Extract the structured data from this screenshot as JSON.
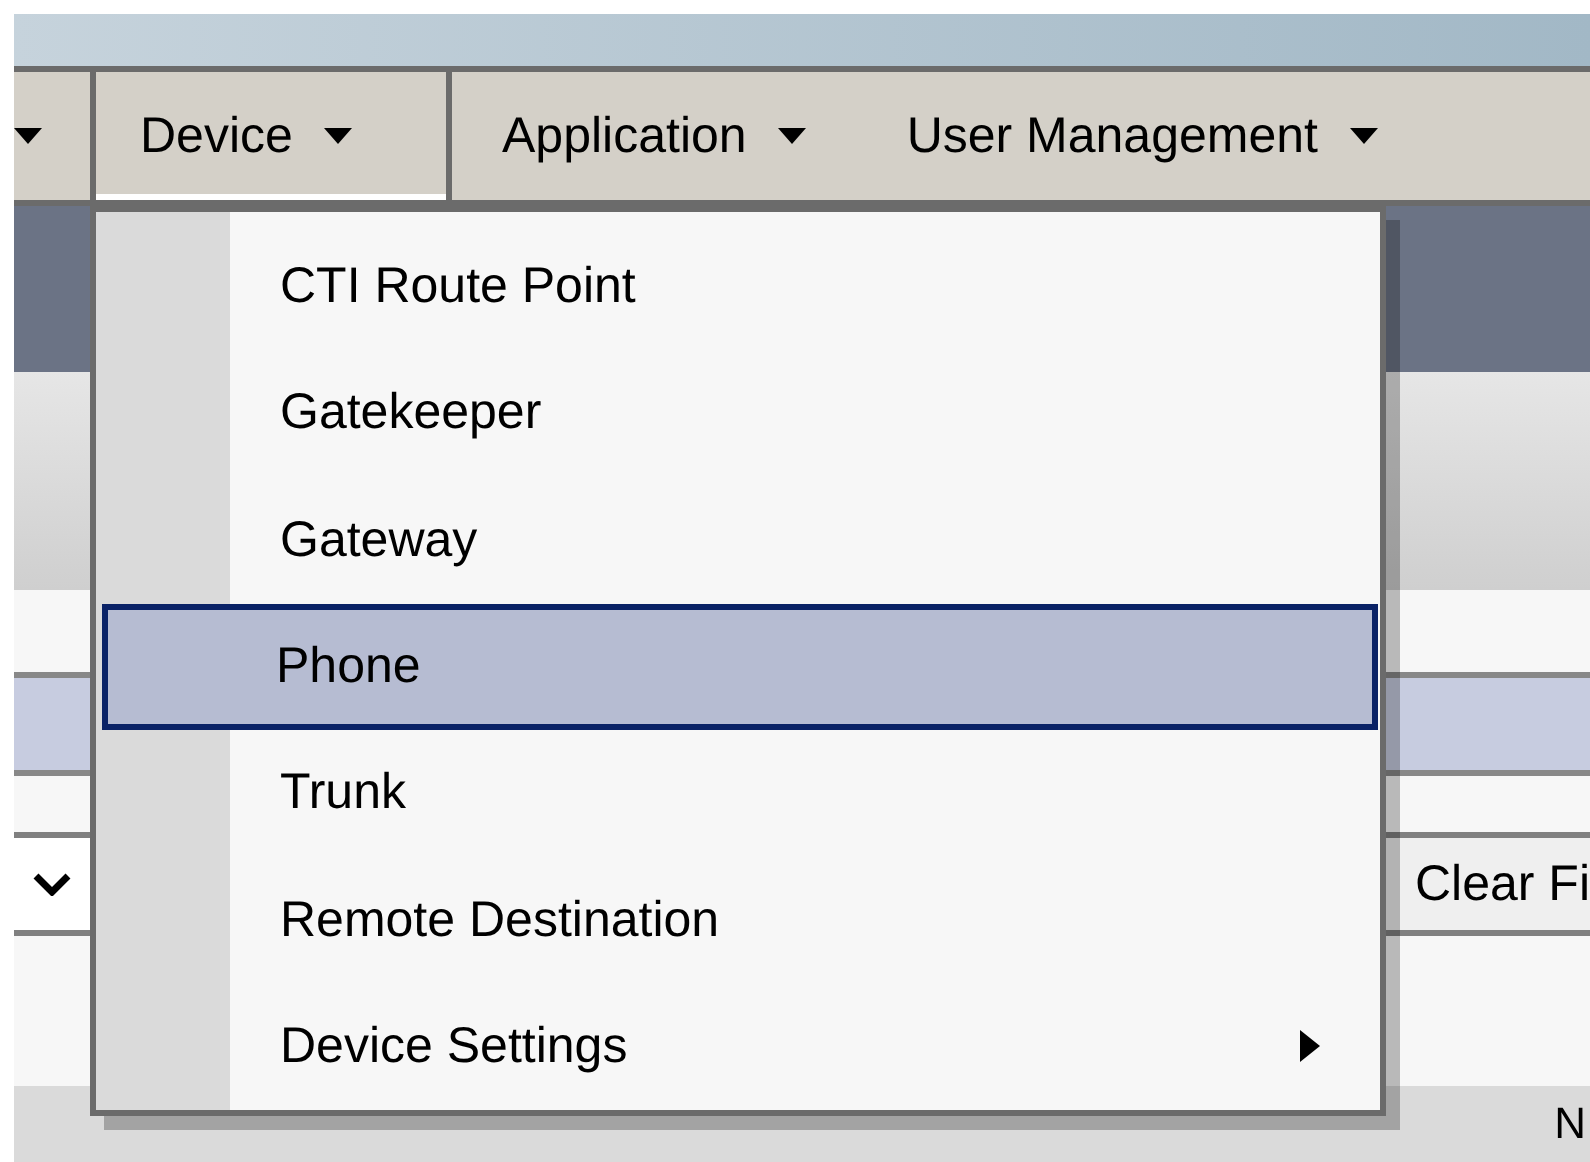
{
  "menu_bar": {
    "items": [
      {
        "label": "Device",
        "selected": true
      },
      {
        "label": "Application",
        "selected": false
      },
      {
        "label": "User Management",
        "selected": false
      }
    ]
  },
  "dropdown": {
    "items": [
      {
        "label": "CTI Route Point",
        "selected": false,
        "has_submenu": false
      },
      {
        "label": "Gatekeeper",
        "selected": false,
        "has_submenu": false
      },
      {
        "label": "Gateway",
        "selected": false,
        "has_submenu": false
      },
      {
        "label": "Phone",
        "selected": true,
        "has_submenu": false
      },
      {
        "label": "Trunk",
        "selected": false,
        "has_submenu": false
      },
      {
        "label": "Remote Destination",
        "selected": false,
        "has_submenu": false
      },
      {
        "label": "Device Settings",
        "selected": false,
        "has_submenu": true
      }
    ]
  },
  "filter_bar": {
    "clear_button": "Clear Fi"
  },
  "footer": {
    "text": "N"
  }
}
